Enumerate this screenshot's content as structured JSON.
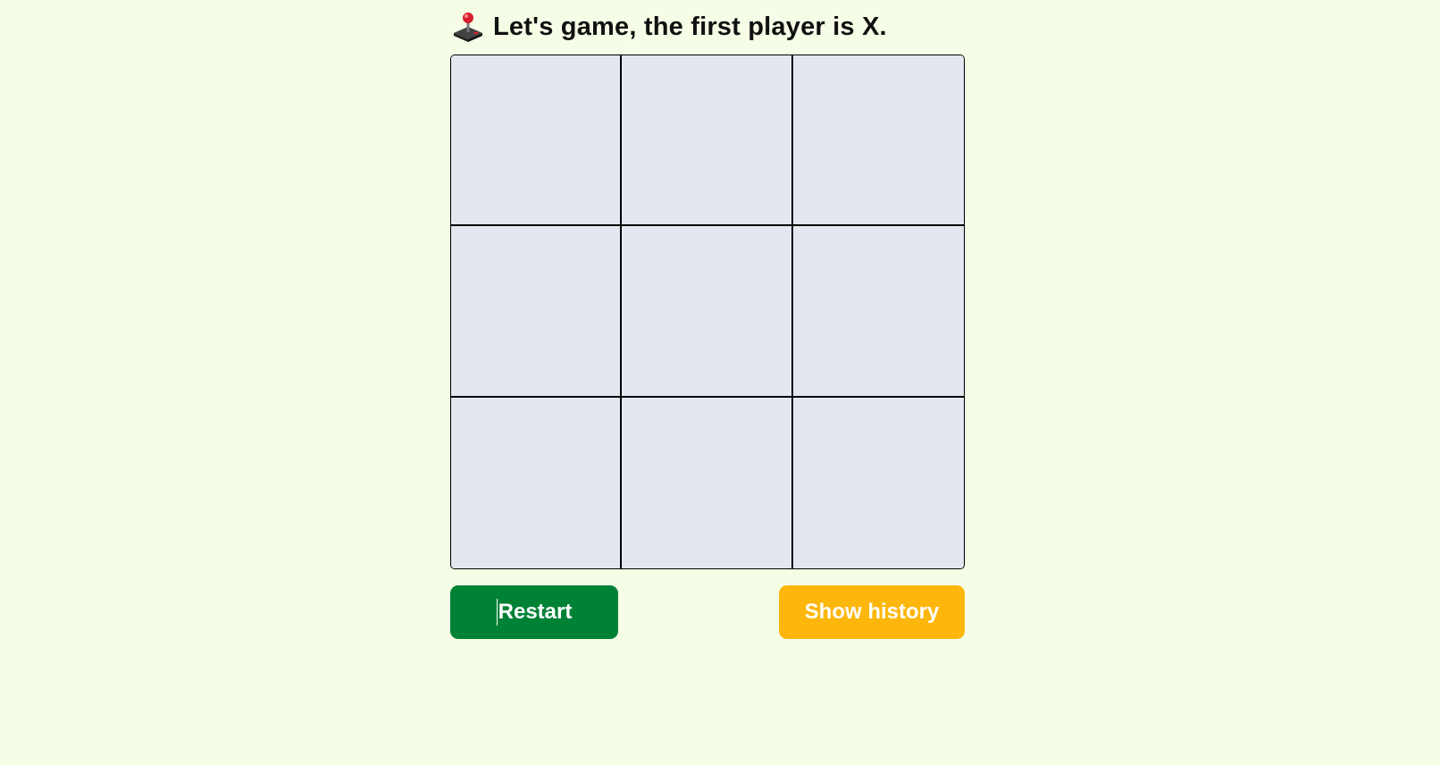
{
  "status": {
    "icon": "joystick-icon",
    "text": "Let's game, the first player is X."
  },
  "board": {
    "cells": [
      "",
      "",
      "",
      "",
      "",
      "",
      "",
      "",
      ""
    ]
  },
  "actions": {
    "restart_label": "Restart",
    "history_label": "Show history"
  },
  "colors": {
    "background": "#f5fde6",
    "cell": "#e2e7f0",
    "restart": "#008236",
    "history": "#fdb70c"
  }
}
